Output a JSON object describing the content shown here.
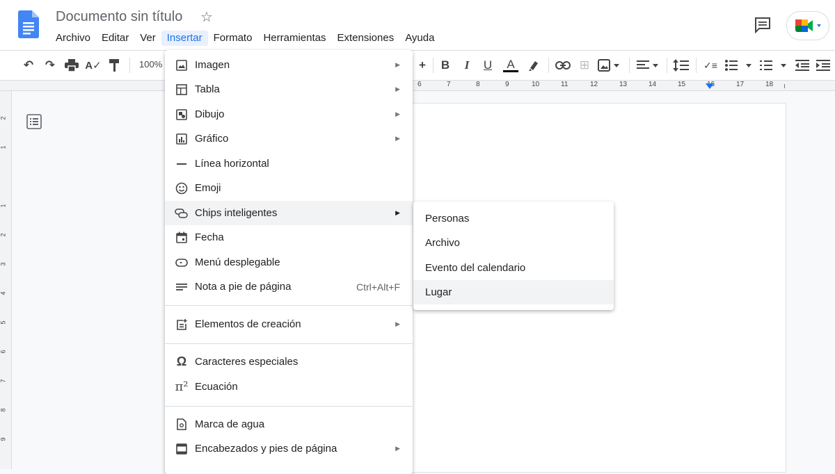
{
  "document": {
    "title": "Documento sin título"
  },
  "menubar": [
    "Archivo",
    "Editar",
    "Ver",
    "Insertar",
    "Formato",
    "Herramientas",
    "Extensiones",
    "Ayuda"
  ],
  "toolbar": {
    "zoom": "100%"
  },
  "ruler": {
    "numbers": [
      "6",
      "7",
      "8",
      "9",
      "10",
      "11",
      "12",
      "13",
      "14",
      "15",
      "16",
      "17",
      "18"
    ]
  },
  "vruler": {
    "numbers": [
      "2",
      "1",
      "1",
      "2",
      "3",
      "4",
      "5",
      "6",
      "7",
      "8",
      "9"
    ]
  },
  "insert_menu": {
    "items": [
      {
        "label": "Imagen",
        "icon": "image-icon",
        "submenu": true
      },
      {
        "label": "Tabla",
        "icon": "table-icon",
        "submenu": true
      },
      {
        "label": "Dibujo",
        "icon": "drawing-icon",
        "submenu": true
      },
      {
        "label": "Gráfico",
        "icon": "chart-icon",
        "submenu": true
      },
      {
        "label": "Línea horizontal",
        "icon": "horizontal-line-icon"
      },
      {
        "label": "Emoji",
        "icon": "emoji-icon"
      },
      {
        "label": "Chips inteligentes",
        "icon": "smart-chips-icon",
        "submenu": true,
        "highlighted": true
      },
      {
        "label": "Fecha",
        "icon": "calendar-icon"
      },
      {
        "label": "Menú desplegable",
        "icon": "dropdown-icon"
      },
      {
        "label": "Nota a pie de página",
        "icon": "footnote-icon",
        "shortcut": "Ctrl+Alt+F"
      },
      {
        "label": "Elementos de creación",
        "icon": "building-blocks-icon",
        "submenu": true
      },
      {
        "label": "Caracteres especiales",
        "icon": "omega-icon"
      },
      {
        "label": "Ecuación",
        "icon": "pi-icon"
      },
      {
        "label": "Marca de agua",
        "icon": "watermark-icon"
      },
      {
        "label": "Encabezados y pies de página",
        "icon": "header-footer-icon",
        "submenu": true
      }
    ]
  },
  "chips_submenu": {
    "items": [
      {
        "label": "Personas"
      },
      {
        "label": "Archivo"
      },
      {
        "label": "Evento del calendario"
      },
      {
        "label": "Lugar",
        "highlighted": true
      }
    ]
  },
  "colors": {
    "accent": "#1a73e8",
    "docs_blue": "#4285f4",
    "text_color_bar": "#000000"
  }
}
